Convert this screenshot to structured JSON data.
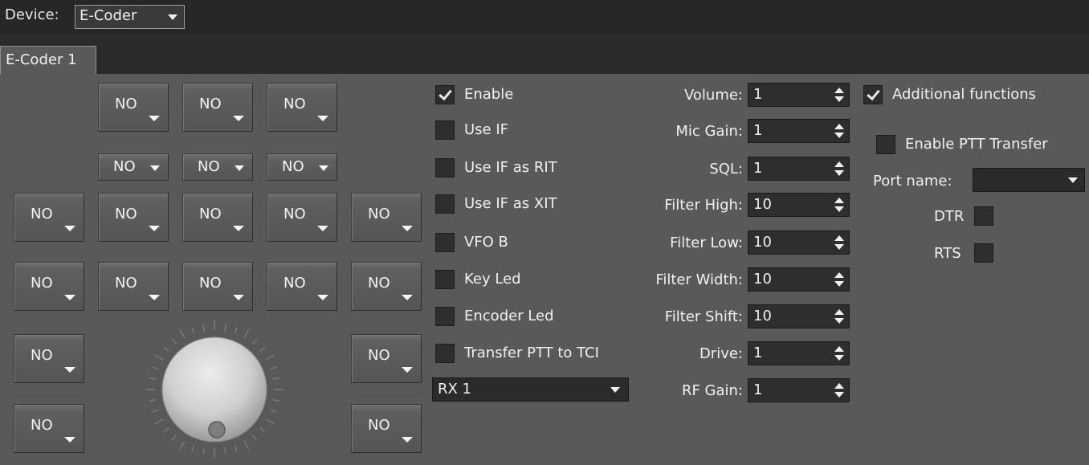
{
  "device": {
    "label": "Device:",
    "value": "E-Coder"
  },
  "tabs": [
    {
      "label": "E-Coder 1"
    }
  ],
  "buttons": {
    "label": "NO"
  },
  "checkboxes": [
    {
      "label": "Enable",
      "checked": true
    },
    {
      "label": "Use IF",
      "checked": false
    },
    {
      "label": "Use IF as RIT",
      "checked": false
    },
    {
      "label": "Use IF as XIT",
      "checked": false
    },
    {
      "label": "VFO B",
      "checked": false
    },
    {
      "label": "Key Led",
      "checked": false
    },
    {
      "label": "Encoder Led",
      "checked": false
    },
    {
      "label": "Transfer PTT to TCI",
      "checked": false
    }
  ],
  "rx_select": {
    "value": "RX 1"
  },
  "fields": [
    {
      "label": "Volume:",
      "value": "1"
    },
    {
      "label": "Mic Gain:",
      "value": "1"
    },
    {
      "label": "SQL:",
      "value": "1"
    },
    {
      "label": "Filter High:",
      "value": "10"
    },
    {
      "label": "Filter Low:",
      "value": "10"
    },
    {
      "label": "Filter Width:",
      "value": "10"
    },
    {
      "label": "Filter Shift:",
      "value": "10"
    },
    {
      "label": "Drive:",
      "value": "1"
    },
    {
      "label": "RF Gain:",
      "value": "1"
    }
  ],
  "additional": {
    "additional_functions": {
      "label": "Additional functions",
      "checked": true
    },
    "enable_ptt_transfer": {
      "label": "Enable PTT Transfer",
      "checked": false
    },
    "port_name": {
      "label": "Port name:",
      "value": ""
    },
    "dtr": {
      "label": "DTR",
      "checked": false
    },
    "rts": {
      "label": "RTS",
      "checked": false
    }
  },
  "colors": {
    "background": "#595959",
    "header": "#272727",
    "field_bg": "#2e2e2e"
  }
}
